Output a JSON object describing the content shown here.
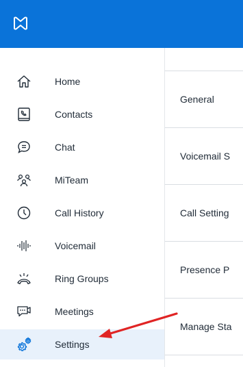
{
  "brand": {
    "accent": "#0a73d9",
    "logo_icon": "mitel-logo-icon"
  },
  "sidebar": {
    "items": [
      {
        "label": "Home",
        "icon": "home-icon"
      },
      {
        "label": "Contacts",
        "icon": "contacts-icon"
      },
      {
        "label": "Chat",
        "icon": "chat-icon"
      },
      {
        "label": "MiTeam",
        "icon": "team-icon"
      },
      {
        "label": "Call History",
        "icon": "clock-icon"
      },
      {
        "label": "Voicemail",
        "icon": "voicemail-waveform-icon"
      },
      {
        "label": "Ring Groups",
        "icon": "ring-groups-icon"
      },
      {
        "label": "Meetings",
        "icon": "meetings-icon"
      },
      {
        "label": "Settings",
        "icon": "gear-icon",
        "active": true
      }
    ]
  },
  "settings_list": {
    "rows": [
      {
        "label": "General"
      },
      {
        "label": "Voicemail S"
      },
      {
        "label": "Call Setting"
      },
      {
        "label": "Presence P"
      },
      {
        "label": "Manage Sta"
      }
    ]
  },
  "annotation": {
    "arrow_color": "#e02424",
    "icon": "red-arrow-icon"
  }
}
